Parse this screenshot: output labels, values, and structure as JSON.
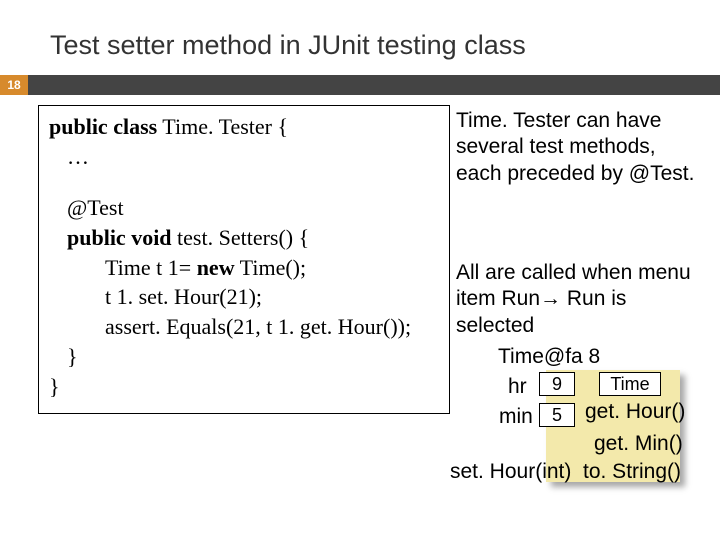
{
  "slide": {
    "title": "Test setter method in JUnit testing class",
    "page_number": "18"
  },
  "code": {
    "line1_kw1": "public class",
    "line1_rest": " Time. Tester {",
    "line2": "…",
    "line3": "@Test",
    "line4_kw1": "public void",
    "line4_rest": " test. Setters() {",
    "line5a": "Time t 1= ",
    "line5_kw": "new",
    "line5b": " Time();",
    "line6": "t 1. set. Hour(21);",
    "line7": "assert. Equals(21, t 1. get. Hour());",
    "line8": "}",
    "line9": "}"
  },
  "right": {
    "para1": "Time. Tester can have several test methods, each preceded by @Test.",
    "para2a": "All are called when menu item Run",
    "para2_arrow": "→",
    "para2b": " Run is selected"
  },
  "object": {
    "ref": "Time@fa 8",
    "hr_label": "hr",
    "hr_value": "9",
    "min_label": "min",
    "min_value": "5",
    "class_label": "Time",
    "m1": "get. Hour()",
    "m2": "get. Min()",
    "m3": "set. Hour(int)",
    "m4": "to. String()"
  }
}
